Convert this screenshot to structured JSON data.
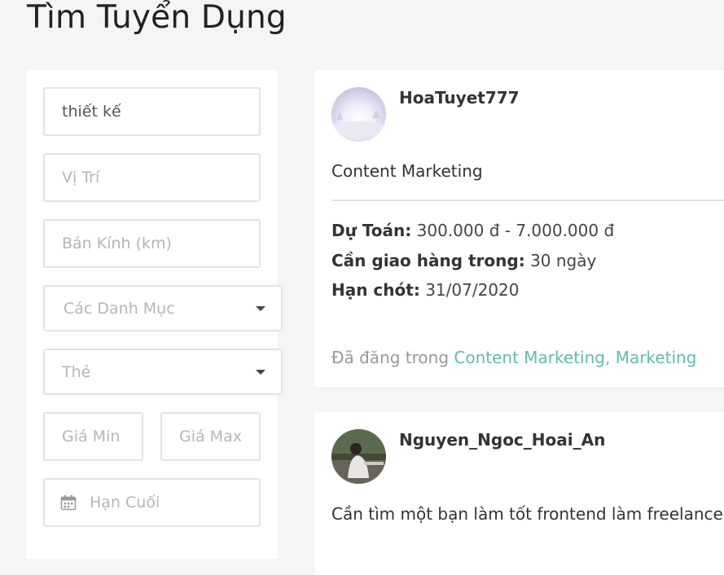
{
  "page": {
    "title": "Tìm Tuyển Dụng"
  },
  "filters": {
    "keyword_value": "thiết kế",
    "location_placeholder": "Vị Trí",
    "radius_placeholder": "Bán Kính (km)",
    "category_placeholder": "Các Danh Mục",
    "tag_placeholder": "Thẻ",
    "price_min_placeholder": "Giá Min",
    "price_max_placeholder": "Giá Max",
    "deadline_placeholder": "Hạn Cuối"
  },
  "listings": [
    {
      "username": "HoaTuyet777",
      "title": "Content Marketing",
      "budget_label": "Dự Toán:",
      "budget_value": "300.000 đ - 7.000.000 đ",
      "delivery_label": "Cần giao hàng trong:",
      "delivery_value": "30 ngày",
      "deadline_label": "Hạn chót:",
      "deadline_value": "31/07/2020",
      "posted_in_label": "Đã đăng trong",
      "categories": [
        "Content Marketing",
        "Marketing"
      ],
      "category_separator": ","
    },
    {
      "username": "Nguyen_Ngoc_Hoai_An",
      "title": "Cần tìm một bạn làm tốt frontend làm freelancer"
    }
  ],
  "colors": {
    "accent": "#5fbbb0",
    "background": "#f4f5f7"
  },
  "icons": {
    "select_caret": "chevron-down-icon",
    "date": "calendar-icon"
  }
}
